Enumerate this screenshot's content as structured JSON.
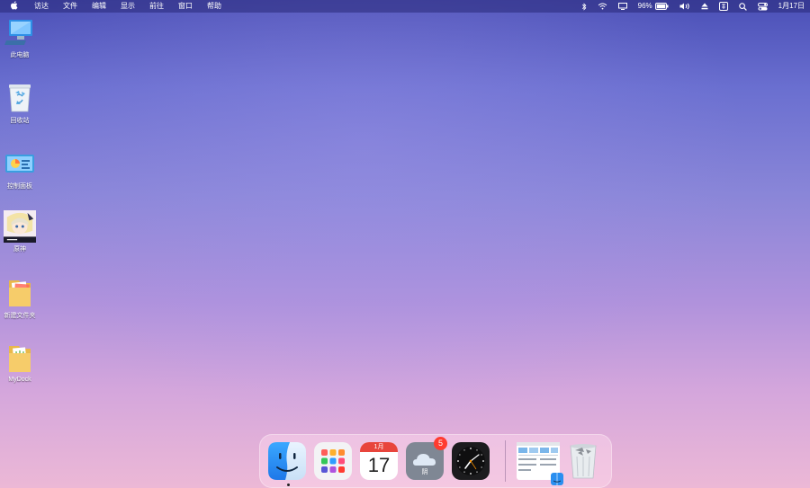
{
  "menubar": {
    "apple_icon": "apple-icon",
    "items": [
      "访达",
      "文件",
      "编辑",
      "显示",
      "前往",
      "窗口",
      "帮助"
    ],
    "status": {
      "battery_percent": "96%",
      "clock": "1月17日"
    }
  },
  "desktop": {
    "icons": [
      {
        "label": "此电脑",
        "icon": "computer-icon"
      },
      {
        "label": "回收站",
        "icon": "recycle-bin-icon"
      },
      {
        "label": "控制面板",
        "icon": "control-panel-icon"
      },
      {
        "label": "原神",
        "icon": "game-icon"
      },
      {
        "label": "新建文件夹",
        "icon": "folder-icon"
      },
      {
        "label": "MyDock",
        "icon": "folder-icon"
      }
    ]
  },
  "dock": {
    "calendar": {
      "month": "1月",
      "day": "17"
    },
    "weather_badge": "5",
    "weather_text": "阴"
  },
  "colors": {
    "accent_finder": "#1e8ff5",
    "badge": "#ff3b30",
    "calendar_header": "#e8453c"
  }
}
